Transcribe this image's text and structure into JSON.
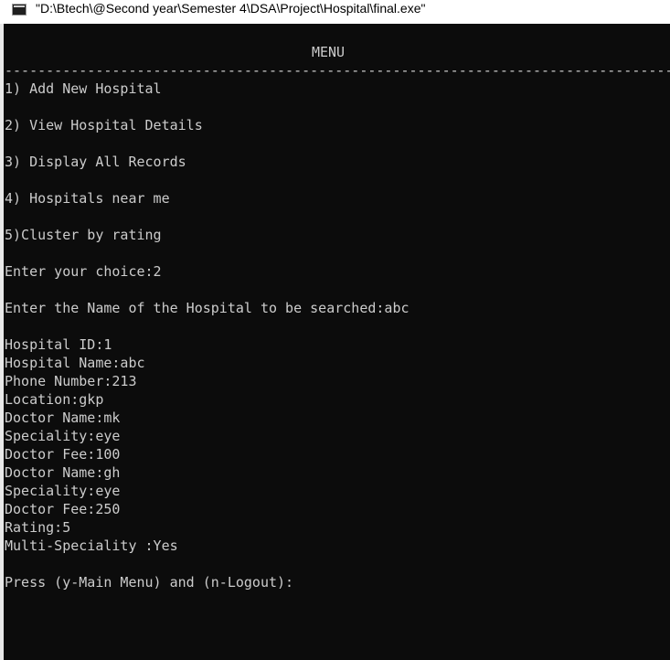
{
  "window": {
    "title": "\"D:\\Btech\\@Second year\\Semester 4\\DSA\\Project\\Hospital\\final.exe\""
  },
  "console": {
    "menu_title": "MENU",
    "rule": "----------------------------------------------------------------------------------",
    "menu_items": [
      "1) Add New Hospital",
      "2) View Hospital Details",
      "3) Display All Records",
      "4) Hospitals near me",
      "5)Cluster by rating"
    ],
    "choice_prompt": "Enter your choice:2",
    "search_prompt": "Enter the Name of the Hospital to be searched:abc",
    "details": [
      "Hospital ID:1",
      "Hospital Name:abc",
      "Phone Number:213",
      "Location:gkp",
      "Doctor Name:mk",
      "Speciality:eye",
      "Doctor Fee:100",
      "Doctor Name:gh",
      "Speciality:eye",
      "Doctor Fee:250",
      "Rating:5",
      "Multi-Speciality :Yes"
    ],
    "final_prompt": "Press (y-Main Menu) and (n-Logout):"
  },
  "colors": {
    "background": "#0c0c0c",
    "text": "#cccccc",
    "titlebar": "#ffffff"
  },
  "icons": {
    "app": "console-app-icon"
  }
}
